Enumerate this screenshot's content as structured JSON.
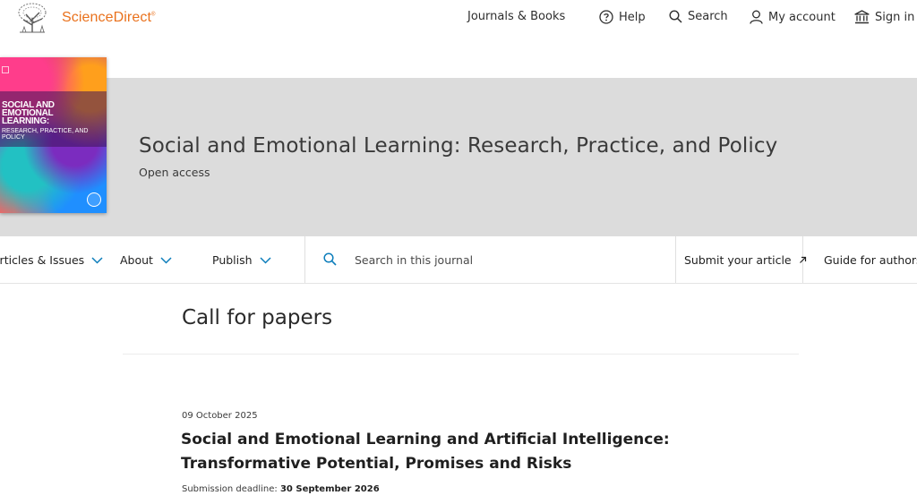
{
  "brand": {
    "name": "ScienceDirect",
    "mark": "®",
    "logo_icon": "elsevier-tree-icon"
  },
  "header": {
    "journals": "Journals & Books",
    "help": "Help",
    "search": "Search",
    "account": "My account",
    "signin": "Sign in"
  },
  "journal": {
    "title": "Social and Emotional Learning: Research, Practice, and Policy",
    "access": "Open access",
    "cover_title": "Social and Emotional Learning:",
    "cover_subtitle": "Research, Practice, and Policy"
  },
  "subnav": {
    "articles": "Articles & Issues",
    "about": "About",
    "publish": "Publish",
    "search_placeholder": "Search in this journal",
    "submit": "Submit your article",
    "guide": "Guide for authors"
  },
  "content": {
    "heading": "Call for papers",
    "item": {
      "date": "09 October 2025",
      "title": "Social and Emotional Learning and Artificial Intelligence: Transformative Potential, Promises and Risks",
      "deadline_label": "Submission deadline:",
      "deadline_value": "30 September 2026"
    }
  },
  "colors": {
    "brand_orange": "#e9711c",
    "link_blue": "#0c7dbb",
    "banner_gray": "#dcdcdc"
  }
}
